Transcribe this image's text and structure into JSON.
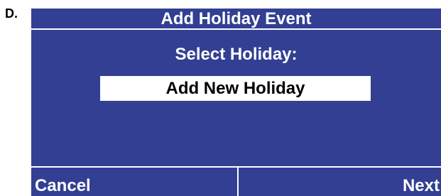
{
  "step": {
    "label": "D."
  },
  "screen": {
    "title": "Add Holiday Event",
    "prompt": "Select Holiday:",
    "selected_option": "Add New Holiday"
  },
  "softkeys": {
    "left_label": "Cancel",
    "right_label": "Next"
  },
  "colors": {
    "screen_background": "#323f93",
    "text": "#ffffff",
    "highlight_background": "#ffffff",
    "highlight_text": "#000000"
  }
}
